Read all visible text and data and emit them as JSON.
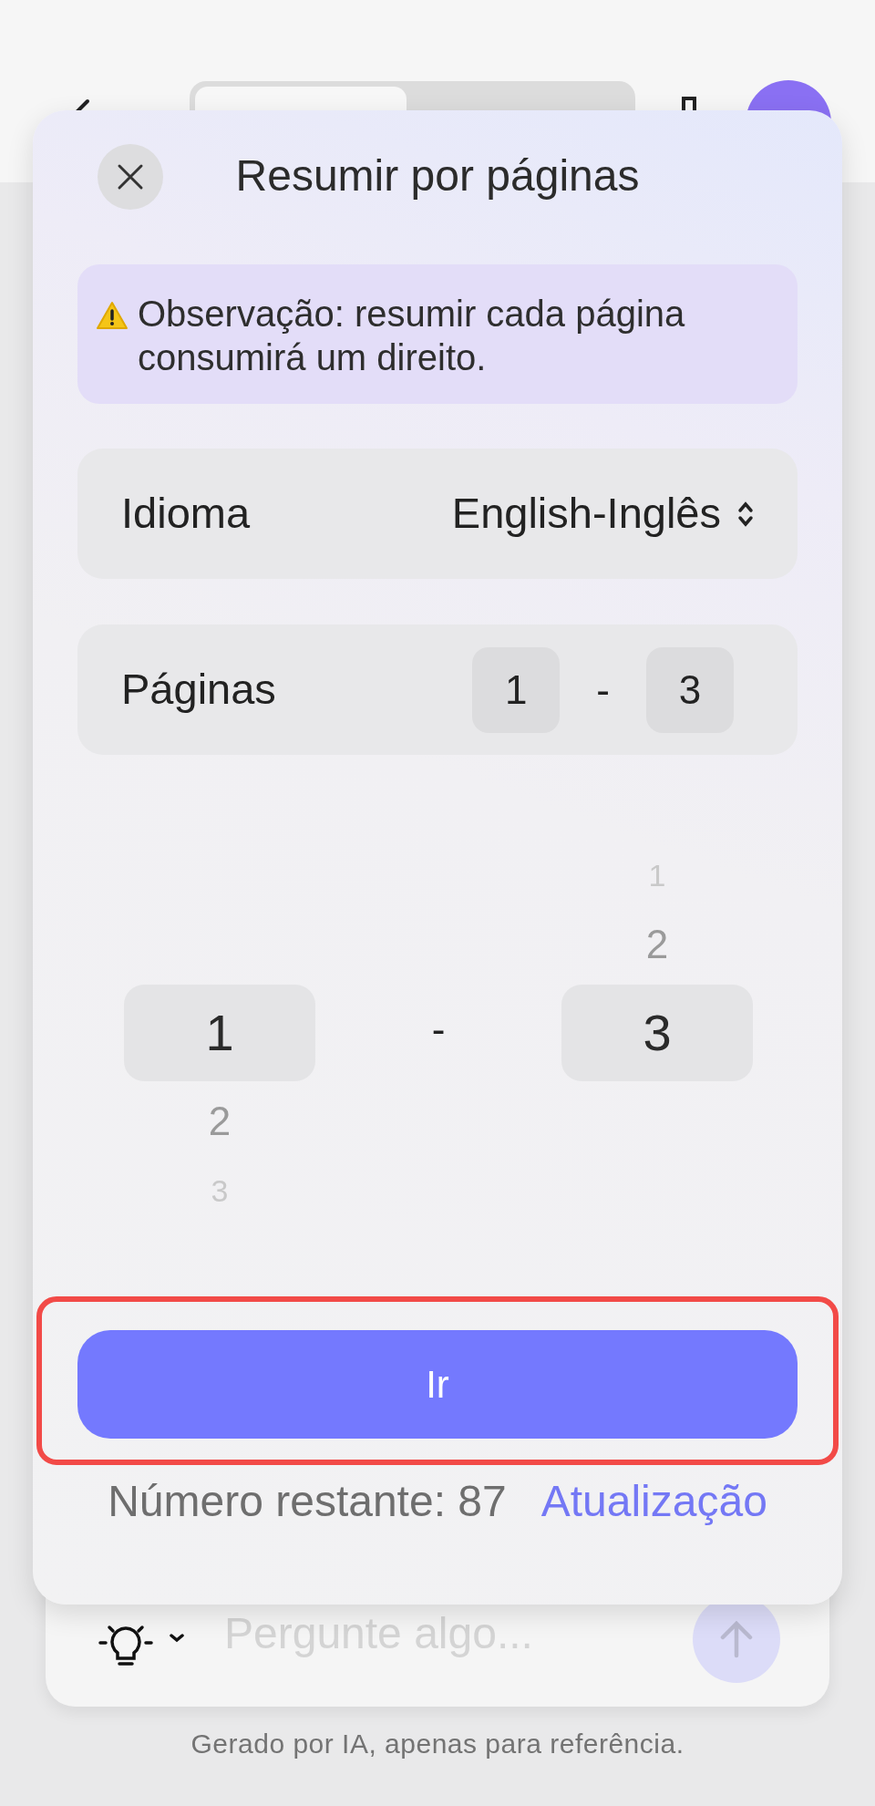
{
  "dialog": {
    "title": "Resumir por páginas",
    "notice": {
      "text": "Observação: resumir cada página consumirá um direito."
    },
    "language": {
      "label": "Idioma",
      "value": "English-Inglês"
    },
    "pages": {
      "label": "Páginas",
      "from": "1",
      "separator": "-",
      "to": "3"
    },
    "picker": {
      "separator": "-",
      "start": [
        {
          "label": "1",
          "selected": true
        },
        {
          "label": "2",
          "selected": false
        },
        {
          "label": "3",
          "selected": false
        }
      ],
      "end": [
        {
          "label": "1",
          "selected": false
        },
        {
          "label": "2",
          "selected": false
        },
        {
          "label": "3",
          "selected": true
        }
      ]
    },
    "go_button": {
      "label": "Ir",
      "highlighted": true
    },
    "remaining": "Número restante: 87",
    "upgrade_link": "Atualização"
  },
  "composer": {
    "placeholder": "Pergunte algo..."
  },
  "disclaimer": "Gerado por IA, apenas para referência."
}
